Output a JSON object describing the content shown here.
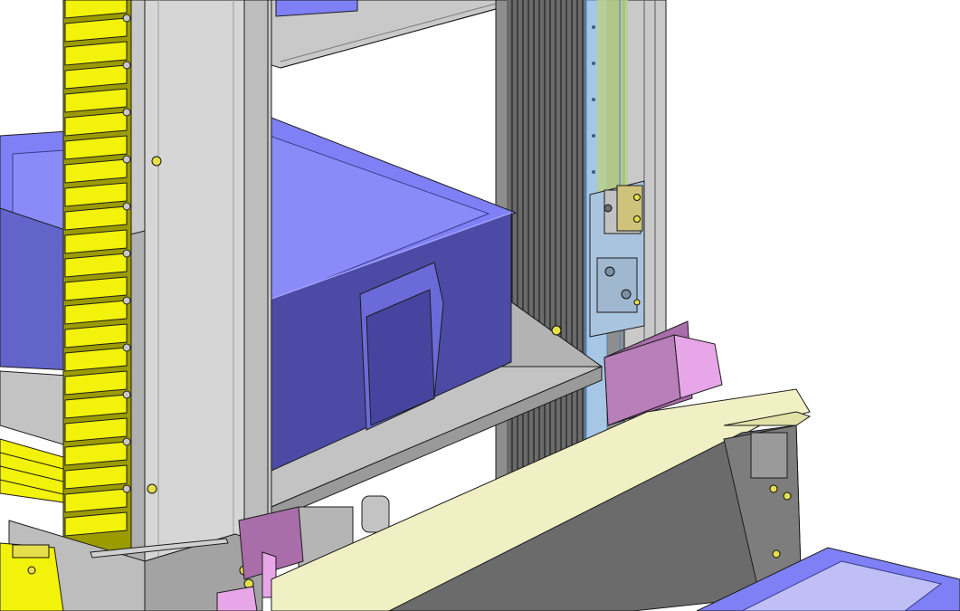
{
  "viewport": {
    "background": "#ffffff"
  },
  "colors": {
    "bin_blue": "#7f80f5",
    "bin_blue_dark": "#4b4ba6",
    "bin_blue_mid": "#6264c9",
    "frame_gray": "#c9c9c9",
    "frame_gray_dark": "#8f8f8f",
    "plate_gray": "#b8b8b8",
    "cable_chain_yellow": "#f2f20a",
    "cable_chain_yellow_dark": "#9b9b00",
    "rail_blue": "#a6c6e6",
    "pad_pink": "#e7a6e7",
    "pad_pink_dark": "#a96da9",
    "conveyor_cream": "#f1f0c4",
    "edge_dark": "#1c1c1c"
  },
  "parts": [
    "cable-chain",
    "storage-bin-upper",
    "storage-bin-lower",
    "vertical-column",
    "lift-shelf",
    "linear-guide",
    "carriage-block",
    "bumper-pad",
    "conveyor-deck",
    "mounting-bracket"
  ]
}
